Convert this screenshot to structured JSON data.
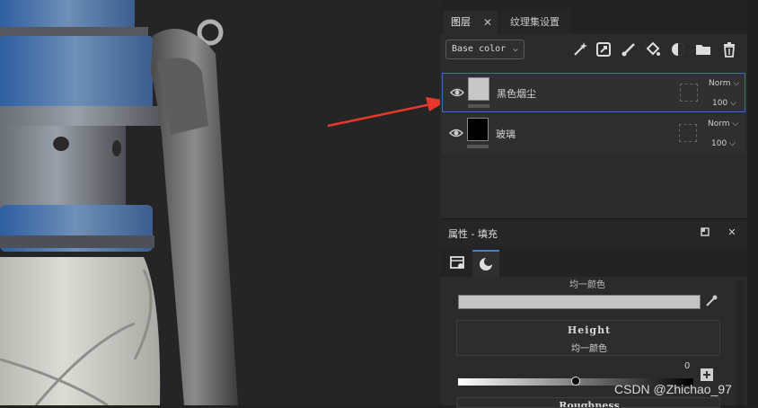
{
  "layers_panel": {
    "tab_layers": "图层",
    "tab_close": "✕",
    "tab_texture_settings": "纹理集设置",
    "channel": "Base color",
    "layers": [
      {
        "name": "黑色烟尘",
        "blend": "Norm",
        "opacity": "100",
        "thumb_color": "#c7c7c7"
      },
      {
        "name": "玻璃",
        "blend": "Norm",
        "opacity": "100",
        "thumb_color": "#000000"
      }
    ]
  },
  "properties": {
    "title": "属性 - 填充",
    "prev_section_label": "均一颜色",
    "base_color_value": "#c4c4c4",
    "height_title": "Height",
    "height_mode": "均一颜色",
    "height_value": "0",
    "height_slider_fraction": 0.5,
    "roughness_title": "Roughness"
  },
  "watermark": "CSDN @Zhichao_97",
  "colors": {
    "accent": "#3b82d6",
    "arrow": "#e8372c"
  }
}
